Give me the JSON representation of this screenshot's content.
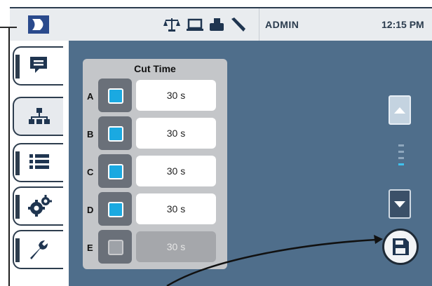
{
  "header": {
    "user": "ADMIN",
    "time": "12:15 PM",
    "icons": [
      "scale-icon",
      "laptop-icon",
      "printer-icon",
      "tool-icon"
    ]
  },
  "sidebar": {
    "tabs": [
      {
        "name": "messages",
        "icon": "message-icon",
        "active": false
      },
      {
        "name": "network",
        "icon": "network-icon",
        "active": true
      },
      {
        "name": "list",
        "icon": "list-icon",
        "active": false
      },
      {
        "name": "settings",
        "icon": "gears-icon",
        "active": false
      },
      {
        "name": "maintenance",
        "icon": "wrench-icon",
        "active": false
      }
    ]
  },
  "cut_time": {
    "title": "Cut Time",
    "rows": [
      {
        "label": "A",
        "value": "30 s",
        "enabled": true
      },
      {
        "label": "B",
        "value": "30 s",
        "enabled": true
      },
      {
        "label": "C",
        "value": "30 s",
        "enabled": true
      },
      {
        "label": "D",
        "value": "30 s",
        "enabled": true
      },
      {
        "label": "E",
        "value": "30 s",
        "enabled": false
      }
    ]
  },
  "colors": {
    "accent": "#1aa9e1",
    "background": "#4f6e8b",
    "header_text": "#2b3c4e"
  }
}
